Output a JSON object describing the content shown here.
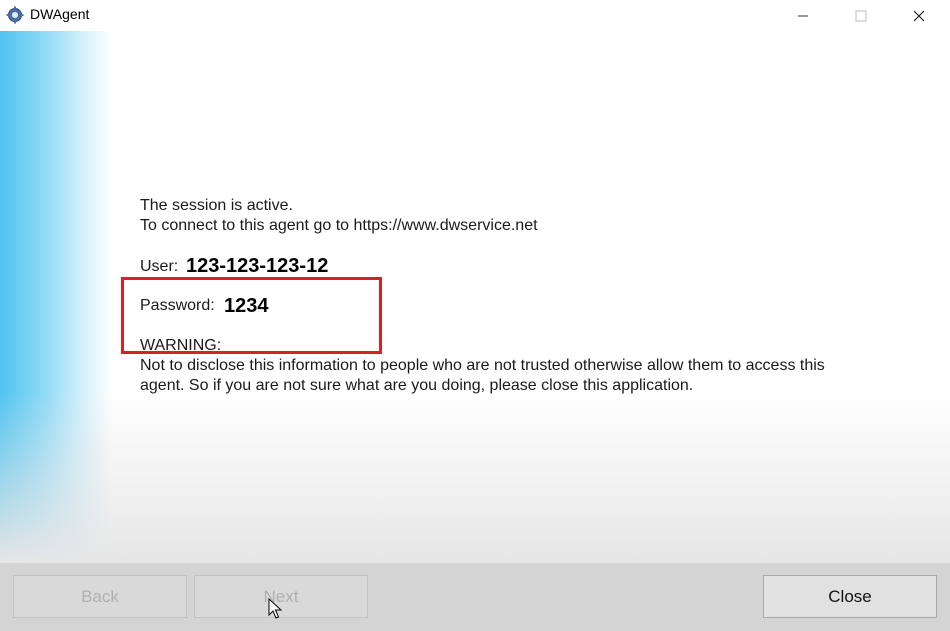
{
  "window": {
    "title": "DWAgent",
    "controls": {
      "minimize": "minimize-icon",
      "maximize": "maximize-icon",
      "close": "close-icon"
    }
  },
  "session": {
    "status": "The session is active.",
    "connect_info": "To connect to this agent go to https://www.dwservice.net",
    "user_label": "User:",
    "user_value": "123-123-123-12",
    "password_label": "Password:",
    "password_value": "1234"
  },
  "warning": {
    "heading": "WARNING:",
    "line1": "Not to disclose this information to people who are not trusted otherwise allow them to access this",
    "line2": "agent. So if you are not sure what are you doing, please close this application."
  },
  "footer": {
    "back_label": "Back",
    "next_label": "Next",
    "close_label": "Close"
  },
  "colors": {
    "accent_blue": "#4fc3f0",
    "highlight_red": "#d7212a",
    "footer_gray": "#d4d4d4"
  }
}
